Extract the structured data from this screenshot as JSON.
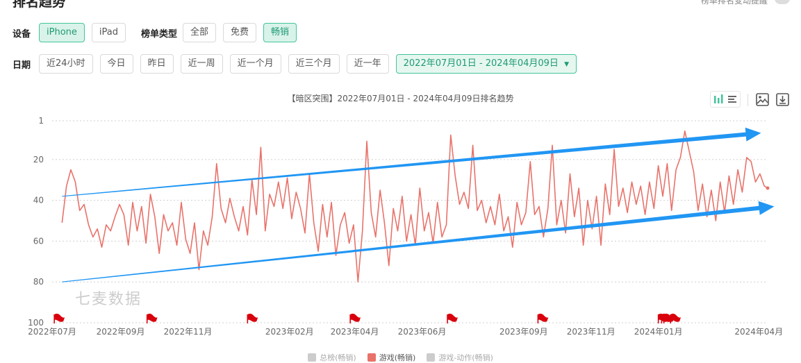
{
  "header": {
    "title": "排名趋势",
    "right_note": "榜单排名变动提醒"
  },
  "device": {
    "label": "设备",
    "options": [
      "iPhone",
      "iPad"
    ],
    "selected": "iPhone"
  },
  "list_type": {
    "label": "榜单类型",
    "options": [
      "全部",
      "免费",
      "畅销"
    ],
    "selected": "畅销"
  },
  "date": {
    "label": "日期",
    "options": [
      "近24小时",
      "今日",
      "昨日",
      "近一周",
      "近一个月",
      "近三个月",
      "近一年"
    ],
    "range": "2022年07月01日 - 2024年04月09日"
  },
  "chart_header": {
    "title": "【暗区突围】2022年07月01日 - 2024年04月09日排名趋势"
  },
  "watermark": "七麦数据",
  "icons": [
    "bar-chart-icon",
    "list-icon",
    "image-download-icon",
    "download-icon",
    "flag-icon",
    "caret-down-icon"
  ],
  "colors": {
    "accent": "#43c49b",
    "line": "#e8726a",
    "arrow": "#2196f3",
    "flag": "#d9000d"
  },
  "chart_data": {
    "type": "line",
    "title": "【暗区突围】2022年07月01日 - 2024年04月09日排名趋势",
    "y_inverted": true,
    "ylim": [
      1,
      100
    ],
    "yticks": [
      1,
      20,
      40,
      60,
      80,
      100
    ],
    "xticks": [
      "2022年07月",
      "2022年09月",
      "2022年11月",
      "2023年02月",
      "2023年04月",
      "2023年06月",
      "2023年09月",
      "2023年11月",
      "2024年01月",
      "2024年04月"
    ],
    "xtick_dates": [
      "2022-07-01",
      "2022-09-01",
      "2022-11-01",
      "2023-02-01",
      "2023-04-01",
      "2023-06-01",
      "2023-09-01",
      "2023-11-01",
      "2024-01-01",
      "2024-04-01"
    ],
    "x_range": [
      "2022-07-01",
      "2024-04-09"
    ],
    "grid": "horizontal-dotted",
    "legend": [
      {
        "name": "总榜(畅销)",
        "active": false,
        "color": "#cccccc"
      },
      {
        "name": "游戏(畅销)",
        "active": true,
        "color": "#e8726a"
      },
      {
        "name": "游戏-动作(畅销)",
        "active": false,
        "color": "#cccccc"
      }
    ],
    "series": [
      {
        "name": "游戏(畅销)",
        "points": [
          [
            "2022-07-10",
            51
          ],
          [
            "2022-07-14",
            33
          ],
          [
            "2022-07-18",
            25
          ],
          [
            "2022-07-22",
            31
          ],
          [
            "2022-07-26",
            45
          ],
          [
            "2022-07-30",
            42
          ],
          [
            "2022-08-03",
            52
          ],
          [
            "2022-08-07",
            58
          ],
          [
            "2022-08-11",
            54
          ],
          [
            "2022-08-15",
            63
          ],
          [
            "2022-08-19",
            52
          ],
          [
            "2022-08-23",
            55
          ],
          [
            "2022-08-27",
            48
          ],
          [
            "2022-08-31",
            42
          ],
          [
            "2022-09-04",
            47
          ],
          [
            "2022-09-08",
            62
          ],
          [
            "2022-09-12",
            41
          ],
          [
            "2022-09-16",
            55
          ],
          [
            "2022-09-20",
            43
          ],
          [
            "2022-09-24",
            61
          ],
          [
            "2022-09-28",
            37
          ],
          [
            "2022-10-02",
            48
          ],
          [
            "2022-10-06",
            66
          ],
          [
            "2022-10-10",
            47
          ],
          [
            "2022-10-14",
            55
          ],
          [
            "2022-10-18",
            51
          ],
          [
            "2022-10-22",
            62
          ],
          [
            "2022-10-26",
            41
          ],
          [
            "2022-10-30",
            59
          ],
          [
            "2022-11-03",
            66
          ],
          [
            "2022-11-07",
            51
          ],
          [
            "2022-11-11",
            74
          ],
          [
            "2022-11-15",
            55
          ],
          [
            "2022-11-19",
            62
          ],
          [
            "2022-11-23",
            48
          ],
          [
            "2022-11-27",
            22
          ],
          [
            "2022-12-01",
            44
          ],
          [
            "2022-12-05",
            51
          ],
          [
            "2022-12-09",
            39
          ],
          [
            "2022-12-13",
            48
          ],
          [
            "2022-12-17",
            55
          ],
          [
            "2022-12-21",
            43
          ],
          [
            "2022-12-25",
            57
          ],
          [
            "2022-12-29",
            30
          ],
          [
            "2023-01-02",
            47
          ],
          [
            "2023-01-06",
            14
          ],
          [
            "2023-01-10",
            55
          ],
          [
            "2023-01-14",
            37
          ],
          [
            "2023-01-18",
            43
          ],
          [
            "2023-01-22",
            31
          ],
          [
            "2023-01-26",
            44
          ],
          [
            "2023-01-30",
            29
          ],
          [
            "2023-02-03",
            49
          ],
          [
            "2023-02-07",
            36
          ],
          [
            "2023-02-11",
            44
          ],
          [
            "2023-02-15",
            56
          ],
          [
            "2023-02-19",
            27
          ],
          [
            "2023-02-23",
            51
          ],
          [
            "2023-02-27",
            65
          ],
          [
            "2023-03-03",
            42
          ],
          [
            "2023-03-07",
            58
          ],
          [
            "2023-03-11",
            41
          ],
          [
            "2023-03-15",
            67
          ],
          [
            "2023-03-19",
            52
          ],
          [
            "2023-03-23",
            46
          ],
          [
            "2023-03-27",
            61
          ],
          [
            "2023-03-31",
            52
          ],
          [
            "2023-04-04",
            80
          ],
          [
            "2023-04-08",
            55
          ],
          [
            "2023-04-12",
            11
          ],
          [
            "2023-04-16",
            46
          ],
          [
            "2023-04-20",
            58
          ],
          [
            "2023-04-24",
            35
          ],
          [
            "2023-04-28",
            51
          ],
          [
            "2023-05-02",
            72
          ],
          [
            "2023-05-06",
            44
          ],
          [
            "2023-05-10",
            55
          ],
          [
            "2023-05-14",
            38
          ],
          [
            "2023-05-18",
            60
          ],
          [
            "2023-05-22",
            47
          ],
          [
            "2023-05-26",
            62
          ],
          [
            "2023-05-30",
            34
          ],
          [
            "2023-06-03",
            55
          ],
          [
            "2023-06-07",
            46
          ],
          [
            "2023-06-11",
            61
          ],
          [
            "2023-06-15",
            41
          ],
          [
            "2023-06-19",
            58
          ],
          [
            "2023-06-23",
            52
          ],
          [
            "2023-06-27",
            8
          ],
          [
            "2023-07-01",
            28
          ],
          [
            "2023-07-05",
            42
          ],
          [
            "2023-07-09",
            36
          ],
          [
            "2023-07-13",
            44
          ],
          [
            "2023-07-17",
            13
          ],
          [
            "2023-07-21",
            45
          ],
          [
            "2023-07-25",
            40
          ],
          [
            "2023-07-29",
            51
          ],
          [
            "2023-08-02",
            43
          ],
          [
            "2023-08-06",
            52
          ],
          [
            "2023-08-10",
            37
          ],
          [
            "2023-08-14",
            55
          ],
          [
            "2023-08-18",
            48
          ],
          [
            "2023-08-22",
            63
          ],
          [
            "2023-08-26",
            41
          ],
          [
            "2023-08-30",
            52
          ],
          [
            "2023-09-03",
            46
          ],
          [
            "2023-09-07",
            21
          ],
          [
            "2023-09-11",
            47
          ],
          [
            "2023-09-15",
            43
          ],
          [
            "2023-09-19",
            58
          ],
          [
            "2023-09-23",
            44
          ],
          [
            "2023-09-27",
            13
          ],
          [
            "2023-10-01",
            52
          ],
          [
            "2023-10-05",
            40
          ],
          [
            "2023-10-09",
            56
          ],
          [
            "2023-10-13",
            27
          ],
          [
            "2023-10-17",
            48
          ],
          [
            "2023-10-21",
            34
          ],
          [
            "2023-10-25",
            62
          ],
          [
            "2023-10-29",
            40
          ],
          [
            "2023-11-02",
            54
          ],
          [
            "2023-11-06",
            38
          ],
          [
            "2023-11-10",
            62
          ],
          [
            "2023-11-14",
            32
          ],
          [
            "2023-11-18",
            47
          ],
          [
            "2023-11-22",
            15
          ],
          [
            "2023-11-26",
            43
          ],
          [
            "2023-11-30",
            34
          ],
          [
            "2023-12-04",
            46
          ],
          [
            "2023-12-08",
            31
          ],
          [
            "2023-12-12",
            42
          ],
          [
            "2023-12-16",
            33
          ],
          [
            "2023-12-20",
            47
          ],
          [
            "2023-12-24",
            31
          ],
          [
            "2023-12-28",
            44
          ],
          [
            "2024-01-01",
            23
          ],
          [
            "2024-01-05",
            38
          ],
          [
            "2024-01-09",
            22
          ],
          [
            "2024-01-13",
            45
          ],
          [
            "2024-01-17",
            25
          ],
          [
            "2024-01-21",
            19
          ],
          [
            "2024-01-25",
            6
          ],
          [
            "2024-01-29",
            16
          ],
          [
            "2024-02-02",
            26
          ],
          [
            "2024-02-06",
            45
          ],
          [
            "2024-02-10",
            32
          ],
          [
            "2024-02-14",
            48
          ],
          [
            "2024-02-18",
            35
          ],
          [
            "2024-02-22",
            50
          ],
          [
            "2024-02-26",
            31
          ],
          [
            "2024-03-01",
            46
          ],
          [
            "2024-03-05",
            28
          ],
          [
            "2024-03-09",
            42
          ],
          [
            "2024-03-13",
            25
          ],
          [
            "2024-03-17",
            36
          ],
          [
            "2024-03-21",
            19
          ],
          [
            "2024-03-25",
            21
          ],
          [
            "2024-03-29",
            31
          ],
          [
            "2024-04-02",
            27
          ],
          [
            "2024-04-06",
            33
          ],
          [
            "2024-04-09",
            34
          ]
        ]
      }
    ],
    "trend_arrows": [
      {
        "from": [
          "2022-07-10",
          38
        ],
        "to": [
          "2024-04-03",
          7
        ],
        "color": "#2196f3"
      },
      {
        "from": [
          "2022-07-10",
          80
        ],
        "to": [
          "2024-04-15",
          43
        ],
        "color": "#2196f3"
      }
    ],
    "event_flags": [
      "2022-07-03",
      "2022-09-25",
      "2022-12-25",
      "2023-03-28",
      "2023-06-24",
      "2023-09-14",
      "2024-01-01",
      "2024-01-04",
      "2024-01-06",
      "2024-01-12"
    ]
  }
}
